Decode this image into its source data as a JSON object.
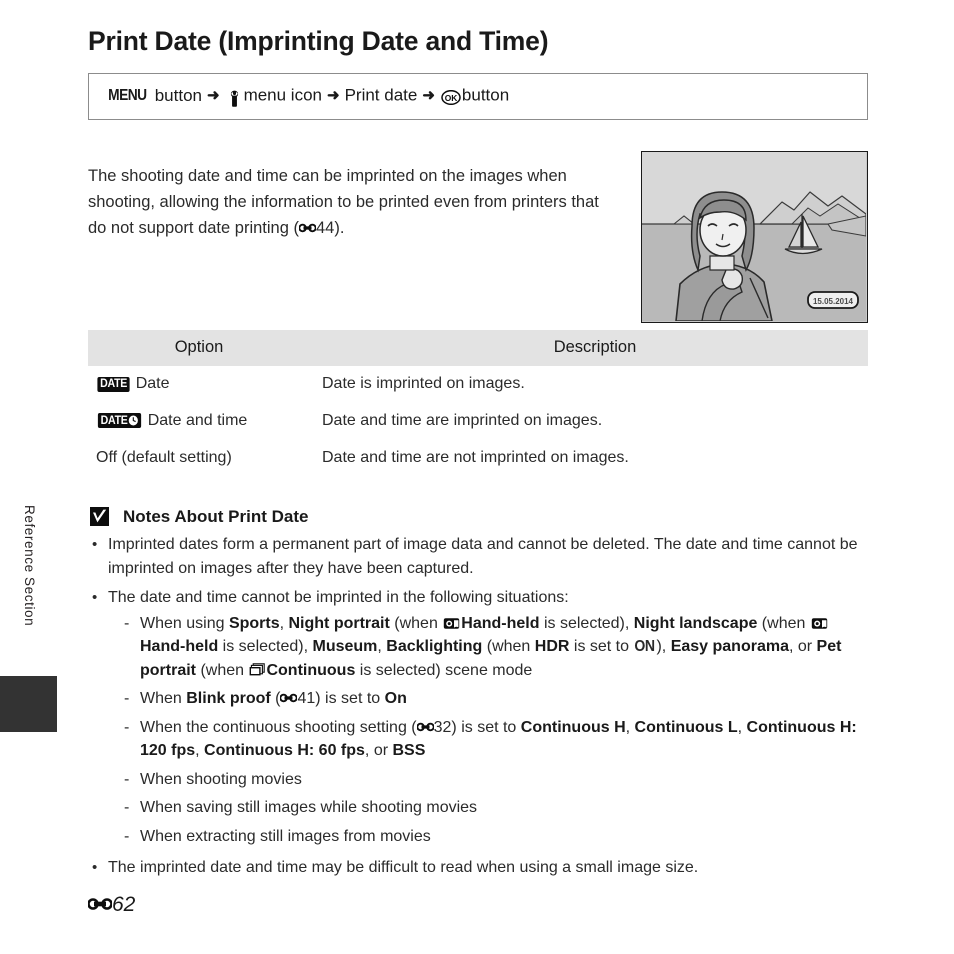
{
  "sidebar": {
    "section_label": "Reference Section"
  },
  "header": {
    "title": "Print Date (Imprinting Date and Time)"
  },
  "breadcrumb": {
    "menu_button": "MENU",
    "button_word_1": "button",
    "arrow": "➜",
    "setup_icon": "wrench-icon",
    "menu_icon_label": "menu icon",
    "item_label": "Print date",
    "ok_icon": "ok-button-icon",
    "button_word_2": "button"
  },
  "intro": {
    "text_part_1": "The shooting date and time can be imprinted on the images when shooting, allowing the information to be printed even from printers that do not support date printing (",
    "ref_icon": "e-reference-icon",
    "ref_page": "44",
    "text_part_2": ")."
  },
  "illustration": {
    "name": "sample-photo-with-date-imprint",
    "date_stamp": "15.05.2014"
  },
  "table": {
    "headers": [
      "Option",
      "Description"
    ],
    "rows": [
      {
        "badge": "DATE",
        "badge_clock": false,
        "option": "Date",
        "description": "Date is imprinted on images."
      },
      {
        "badge": "DATE",
        "badge_clock": true,
        "option": "Date and time",
        "description": "Date and time are imprinted on images."
      },
      {
        "badge": "",
        "badge_clock": false,
        "option": "Off (default setting)",
        "description": "Date and time are not imprinted on images."
      }
    ]
  },
  "notes": {
    "heading": "Notes About Print Date",
    "icon": "caution-check-icon",
    "bullet_1": "Imprinted dates form a permanent part of image data and cannot be deleted. The date and time cannot be imprinted on images after they have been captured.",
    "bullet_2": "The date and time cannot be imprinted in the following situations:",
    "sub_1": {
      "t1": "When using ",
      "b1": "Sports",
      "t2": ", ",
      "b2": "Night portrait",
      "t3": " (when ",
      "icon1": "hand-held-icon",
      "b3": "Hand-held",
      "t4": " is selected), ",
      "b4": "Night landscape",
      "t5": " (when ",
      "icon2": "hand-held-icon",
      "b5": "Hand-held",
      "t6": " is selected), ",
      "b6": "Museum",
      "t7": ", ",
      "b7": "Backlighting",
      "t8": " (when ",
      "b8": "HDR",
      "t9": " is set to ",
      "on": "ON",
      "t10": "), ",
      "b9": "Easy panorama",
      "t11": ", or ",
      "b10": "Pet portrait",
      "t12": " (when ",
      "icon3": "continuous-icon",
      "b11": "Continuous",
      "t13": " is selected) scene mode"
    },
    "sub_2": {
      "t1": "When ",
      "b1": "Blink proof",
      "t2": " (",
      "ref_icon": "e-reference-icon",
      "ref_page": "41",
      "t3": ") is set to ",
      "b2": "On"
    },
    "sub_3": {
      "t1": "When the continuous shooting setting (",
      "ref_icon": "e-reference-icon",
      "ref_page": "32",
      "t2": ") is set to ",
      "b1": "Continuous H",
      "t3": ", ",
      "b2": "Continuous L",
      "t4": ", ",
      "b3": "Continuous H: 120 fps",
      "t5": ", ",
      "b4": "Continuous H: 60 fps",
      "t6": ", or ",
      "b5": "BSS"
    },
    "sub_4": "When shooting movies",
    "sub_5": "When saving still images while shooting movies",
    "sub_6": "When extracting still images from movies",
    "bullet_3": "The imprinted date and time may be difficult to read when using a small image size."
  },
  "footer": {
    "ref_icon": "e-reference-icon",
    "page_number": "62"
  },
  "colors": {
    "text": "#2b2b2b",
    "heading": "#1a1a1a",
    "rule": "#7d7d7d",
    "table_header_bg": "#e3e3e3",
    "tab_dark": "#333333"
  }
}
